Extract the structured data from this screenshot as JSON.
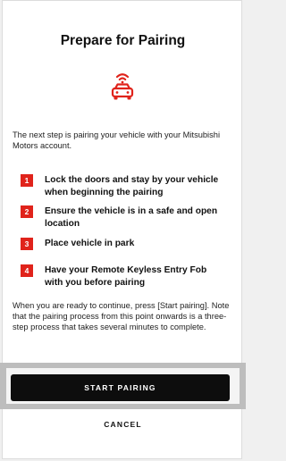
{
  "header": {
    "title": "Prepare for Pairing",
    "hero_icon": "connected-car-icon",
    "accent_color": "#e0231b"
  },
  "intro": "The next step is pairing your vehicle with your Mitsubishi Motors account.",
  "steps": [
    {
      "number": "1",
      "text": "Lock the doors and stay by your vehicle when beginning the pairing"
    },
    {
      "number": "2",
      "text": "Ensure the vehicle is in a safe and open location"
    },
    {
      "number": "3",
      "text": "Place vehicle in park"
    },
    {
      "number": "4",
      "text": "Have your Remote Keyless Entry Fob with you before pairing"
    }
  ],
  "note": "When you are ready to continue, press [Start pairing]. Note that the pairing process from this point onwards is a three-step process that takes several minutes to complete.",
  "actions": {
    "start_label": "START PAIRING",
    "cancel_label": "CANCEL"
  }
}
